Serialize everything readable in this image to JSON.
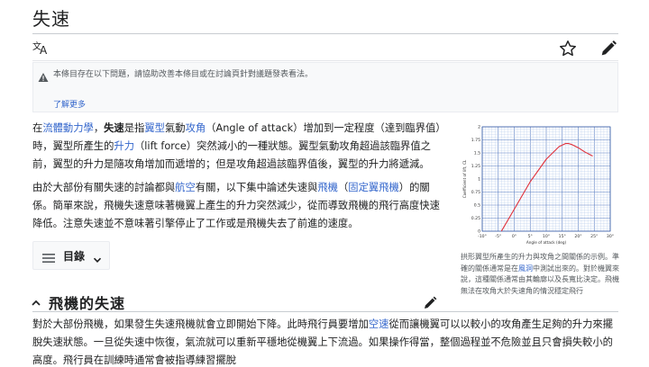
{
  "article": {
    "title": "失速"
  },
  "notice": {
    "text": "本條目存在以下問題，請協助改善本條目或在討論頁針對議題發表看法。",
    "more_link": "了解更多"
  },
  "toc": {
    "label": "目錄"
  },
  "intro": {
    "s1": "在",
    "l1": "流體動力學",
    "s2": "，",
    "b1": "失速",
    "s3": "是指",
    "l2": "翼型",
    "s4": "氣動",
    "l3": "攻角",
    "s5": "（Angle of attack）增加到一定程度（達到臨界值）時，翼型所產生的",
    "l4": "升力",
    "s6": "（lift force）突然減小的一種狀態。翼型氣動攻角超過該臨界值之前，翼型的升力是隨攻角增加而遞增的；但是攻角超過該臨界值後，翼型的升力將遞減。"
  },
  "para2": {
    "s1": "由於大部份有關失速的討論都與",
    "l1": "航空",
    "s2": "有關，以下集中論述失速與",
    "l2": "飛機",
    "s3": "（",
    "l3": "固定翼飛機",
    "s4": "）的關係。簡單來說，飛機失速意味著機翼上產生的升力突然減少，從而導致飛機的飛行高度快速降低。注意失速並不意味著引擎停止了工作或是飛機失去了前進的速度。"
  },
  "section": {
    "title": "飛機的失速"
  },
  "para3": {
    "s1": "對於大部份飛機，如果發生失速飛機就會立即開始下降。此時飛行員要增加",
    "l1": "空速",
    "s2": "從而讓機翼可以以較小的攻角產生足夠的升力來擺脫失速狀態。一旦從失速中恢復，氣流就可以重新平穩地從機翼上下流過。如果操作得當，整個過程並不危險並且只會損失較小的高度。飛行員在訓練時通常會被指導練習擺脫"
  },
  "figure": {
    "caption_s1": "拱形翼型所產生的升力與攻角之間關係的示例。準確的關係通常是在",
    "caption_link": "風洞",
    "caption_s2": "中測試出來的。對於機翼來說，這種關係通常由其輪廓以及長寬比決定。飛機無法在攻角大於失速角的情況穩定飛行"
  },
  "chart_data": {
    "type": "line",
    "xlabel": "Angle of attack (deg)",
    "ylabel": "Coefficient of lift, CL",
    "x_ticks": [
      "-10°",
      "-5°",
      "0°",
      "5°",
      "10°",
      "15°",
      "20°",
      "25°",
      "30°"
    ],
    "y_ticks": [
      "0",
      "0.25",
      "0.5",
      "0.75",
      "1",
      "1.25",
      "1.5",
      "1.75",
      "2"
    ],
    "xlim": [
      -10,
      30
    ],
    "ylim": [
      0,
      2
    ],
    "grid": true,
    "series": [
      {
        "x": [
          -4,
          0,
          5,
          10,
          14,
          16,
          17,
          18,
          20,
          22,
          24.5
        ],
        "y": [
          0,
          0.42,
          0.95,
          1.38,
          1.62,
          1.68,
          1.68,
          1.66,
          1.6,
          1.52,
          1.44
        ],
        "color": "#e0303a"
      }
    ]
  }
}
